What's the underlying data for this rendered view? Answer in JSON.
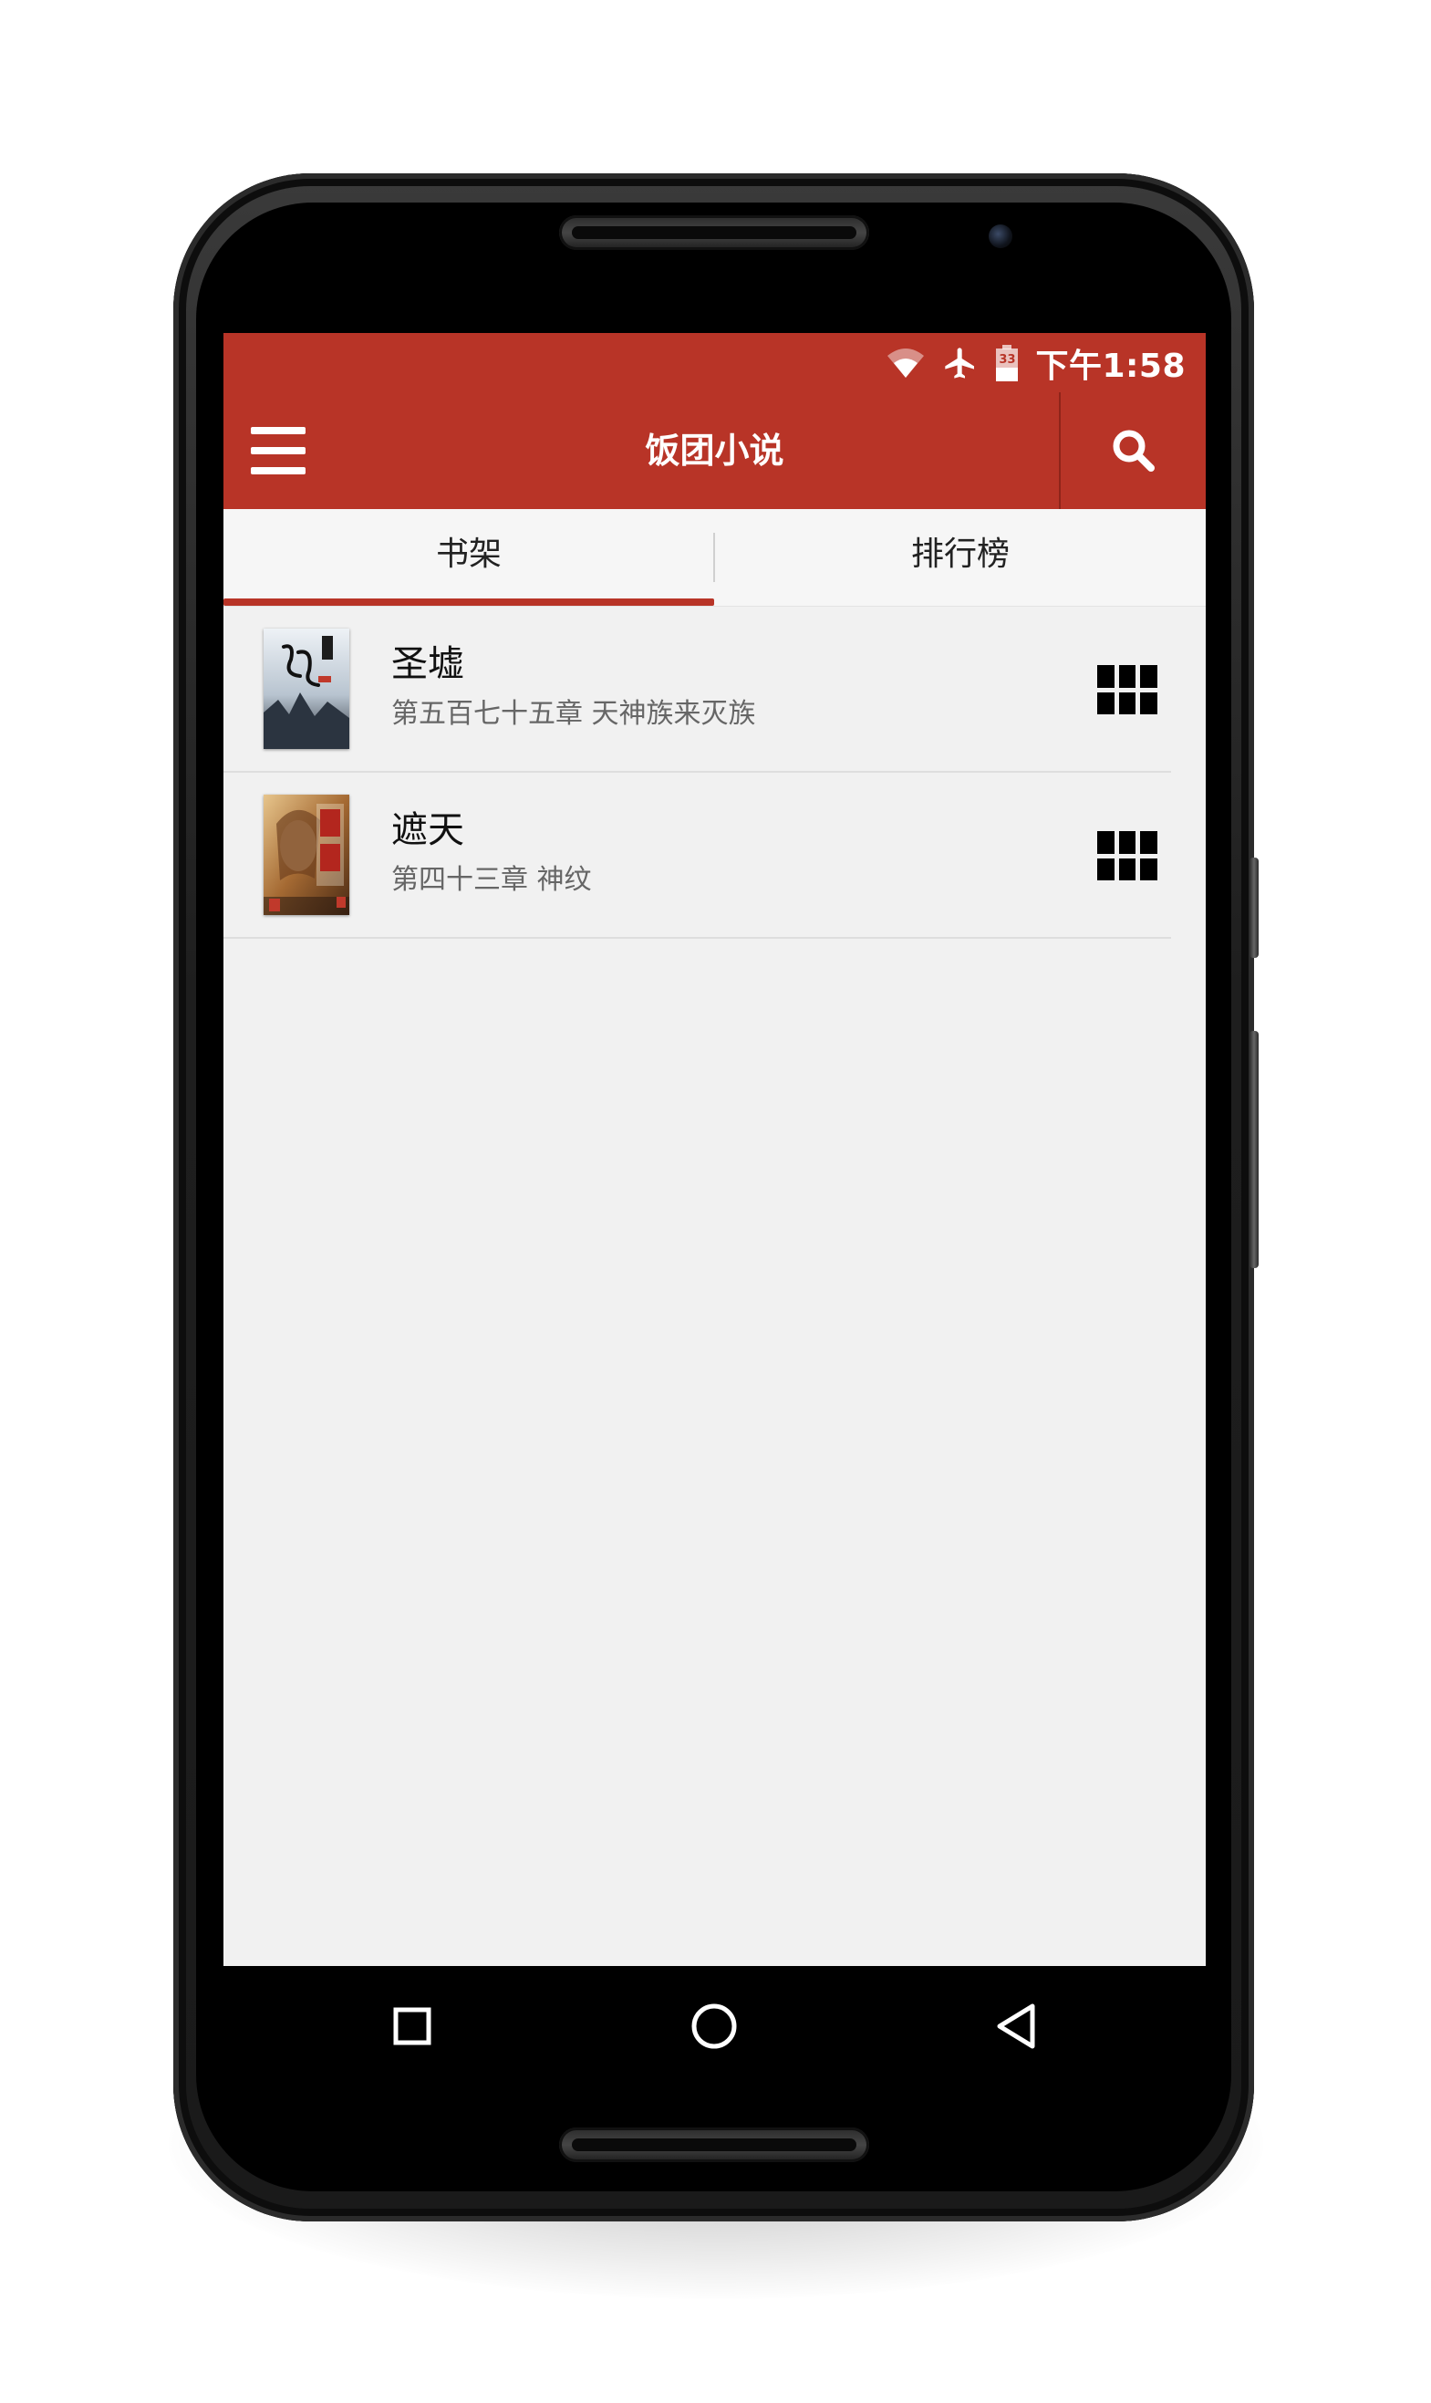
{
  "statusbar": {
    "time": "下午1:58",
    "battery_level": "33",
    "icons": [
      "wifi-icon",
      "airplane-icon",
      "battery-icon"
    ]
  },
  "appbar": {
    "title": "饭团小说",
    "menu_icon": "menu-icon",
    "search_icon": "search-icon"
  },
  "tabs": [
    {
      "label": "书架",
      "selected": true
    },
    {
      "label": "排行榜",
      "selected": false
    }
  ],
  "books": [
    {
      "title": "圣墟",
      "latest_chapter": "第五百七十五章 天神族来灭族",
      "cover_icon": "book-cover-image",
      "action_icon": "grid-icon"
    },
    {
      "title": "遮天",
      "latest_chapter": "第四十三章 神纹",
      "cover_icon": "book-cover-image",
      "action_icon": "grid-icon"
    }
  ],
  "navbar": {
    "icons": [
      "recents-icon",
      "home-icon",
      "back-icon"
    ]
  },
  "colors": {
    "brand": "#b83427",
    "background": "#f1f1f1",
    "tab_indicator": "#b83427"
  }
}
